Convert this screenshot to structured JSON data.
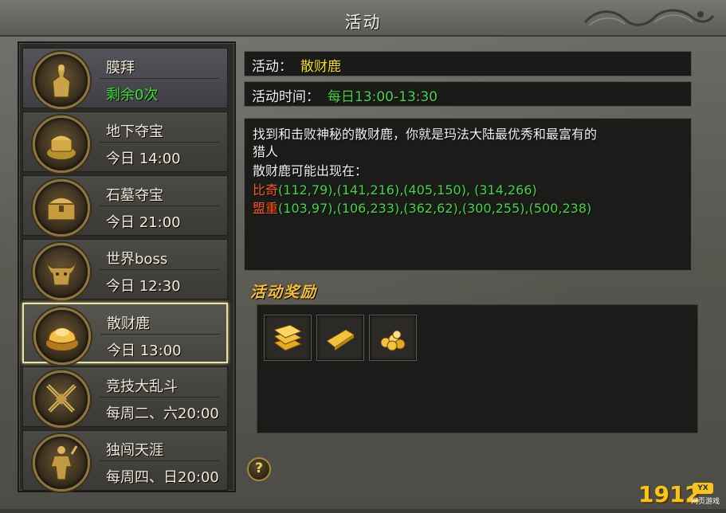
{
  "window": {
    "title": "活动"
  },
  "activities": [
    {
      "icon": "worship-statue-icon",
      "name": "膜拜",
      "sub": "剩余0次",
      "sub_color": "green"
    },
    {
      "icon": "underground-treasure-icon",
      "name": "地下夺宝",
      "sub": "今日 14:00"
    },
    {
      "icon": "treasure-chest-icon",
      "name": "石墓夺宝",
      "sub": "今日 21:00"
    },
    {
      "icon": "bull-demon-icon",
      "name": "世界boss",
      "sub": "今日 12:30"
    },
    {
      "icon": "gold-ingot-icon",
      "name": "散财鹿",
      "sub": "今日 13:00",
      "selected": true
    },
    {
      "icon": "crossed-swords-icon",
      "name": "竞技大乱斗",
      "sub": "每周二、六20:00"
    },
    {
      "icon": "warrior-statue-icon",
      "name": "独闯天涯",
      "sub": "每周四、日20:00"
    }
  ],
  "detail": {
    "activity_label": "活动：",
    "activity_name": "散财鹿",
    "time_label": "活动时间：",
    "time_value": "每日13:00-13:30",
    "desc_line1": "找到和击败神秘的散财鹿，你就是玛法大陆最优秀和最富有的",
    "desc_line2": "猎人",
    "desc_line3": "散财鹿可能出现在：",
    "loc1_name": "比奇",
    "loc1_coords": "(112,79),(141,216),(405,150), (314,266)",
    "loc2_name": "盟重",
    "loc2_coords": "(103,97),(106,233),(362,62),(300,255),(500,238)"
  },
  "rewards": {
    "title": "活动奖励",
    "items": [
      "gold-bars-icon",
      "gold-bar-icon",
      "gold-coins-icon"
    ]
  },
  "help": {
    "label": "?"
  },
  "logo": {
    "number": "1912",
    "badge": "YX",
    "sub": "网页游戏"
  },
  "colors": {
    "accent_yellow": "#f5e000",
    "accent_green": "#41d843",
    "accent_red": "#ff5a1a",
    "selected_border": "#e8e1a8"
  }
}
